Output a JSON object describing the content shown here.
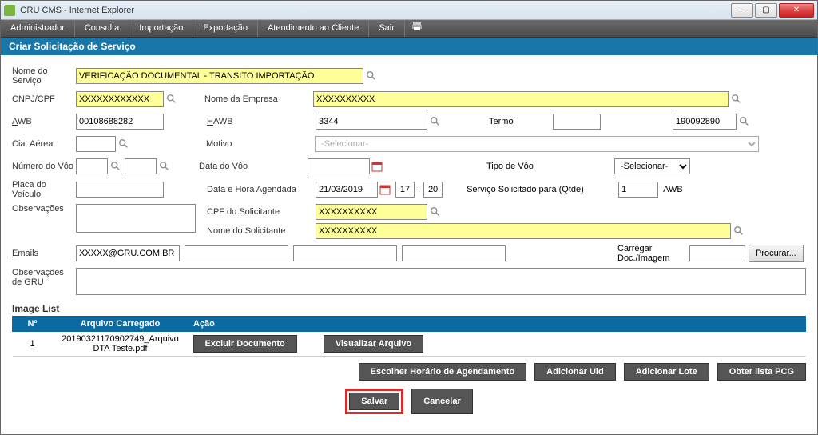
{
  "window": {
    "title": "GRU CMS - Internet Explorer",
    "controls": {
      "min": "–",
      "max": "▢",
      "close": "✕"
    }
  },
  "menubar": [
    "Administrador",
    "Consulta",
    "Importação",
    "Exportação",
    "Atendimento ao Cliente",
    "Sair"
  ],
  "page_title": "Criar Solicitação de Serviço",
  "labels": {
    "nome_servico": "Nome do Serviço",
    "cnpj": "CNPJ/CPF",
    "nome_empresa": "Nome da Empresa",
    "awb": "AWB",
    "hawb": "HAWB",
    "termo": "Termo",
    "cia_aerea": "Cia. Aérea",
    "motivo": "Motivo",
    "numero_voo": "Número do Vôo",
    "data_voo": "Data do Vôo",
    "tipo_voo": "Tipo de Vôo",
    "placa_veiculo": "Placa do Veículo",
    "data_hora": "Data e Hora Agendada",
    "servico_qtde": "Serviço Solicitado para (Qtde)",
    "awb_suffix": "AWB",
    "observacoes": "Observações",
    "cpf_solicitante": "CPF do Solicitante",
    "nome_solicitante": "Nome do Solicitante",
    "emails": "Emails",
    "carregar_doc": "Carregar Doc./Imagem",
    "obs_gru": "Observações de GRU"
  },
  "values": {
    "nome_servico": "VERIFICAÇÃO DOCUMENTAL - TRANSITO IMPORTAÇÃO",
    "cnpj": "XXXXXXXXXXXX",
    "nome_empresa": "XXXXXXXXXX",
    "awb": "00108688282",
    "hawb": "3344",
    "termo": "",
    "termo_right": "190092890",
    "cia_aerea": "",
    "motivo": "-Selecionar-",
    "numero_voo1": "",
    "numero_voo2": "",
    "data_voo": "",
    "tipo_voo": "-Selecionar-",
    "placa_veiculo": "",
    "data_agendada": "21/03/2019",
    "hora_h": "17",
    "hora_m": "20",
    "qtde": "1",
    "cpf_solicitante": "XXXXXXXXXX",
    "nome_solicitante": "XXXXXXXXXX",
    "email1": "XXXXX@GRU.COM.BR",
    "email2": "",
    "email3": "",
    "email4": "",
    "observacoes": "",
    "obs_gru": "",
    "doc_path": ""
  },
  "browse_btn": "Procurar...",
  "image_list": {
    "title": "Image List",
    "headers": [
      "Nº",
      "Arquivo Carregado",
      "Ação"
    ],
    "rows": [
      {
        "no": "1",
        "file": "20190321170902749_Arquivo DTA Teste.pdf"
      }
    ]
  },
  "buttons": {
    "excluir": "Excluir Documento",
    "visualizar": "Visualizar Arquivo",
    "escolher": "Escolher Horário de Agendamento",
    "add_uld": "Adicionar Uld",
    "add_lote": "Adicionar Lote",
    "obter_pcg": "Obter lista PCG",
    "salvar": "Salvar",
    "cancelar": "Cancelar"
  }
}
